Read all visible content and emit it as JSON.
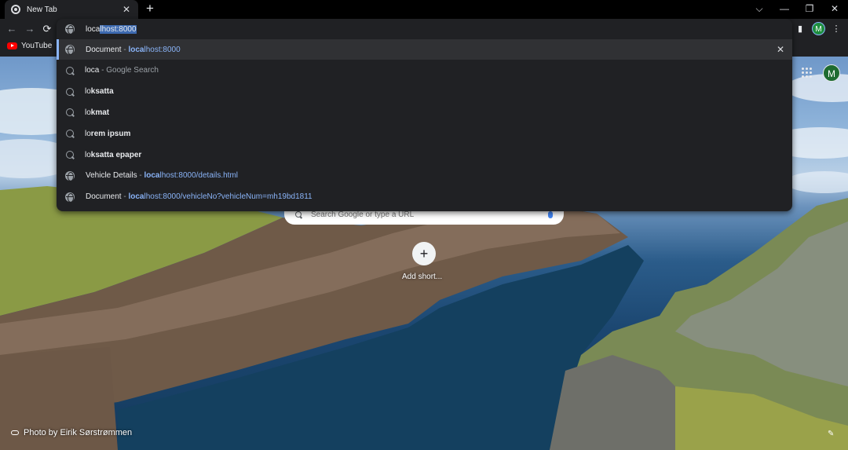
{
  "tab": {
    "title": "New Tab",
    "close": "✕",
    "new_tab": "+"
  },
  "window_controls": {
    "dropdown": "⌵",
    "minimize": "—",
    "restore": "❐",
    "close": "✕"
  },
  "toolbar": {
    "back": "←",
    "forward": "→",
    "reload": "⟳",
    "sidepanel": "▮",
    "profile": "M",
    "menu": "⋮"
  },
  "bookmarks": [
    {
      "label": "YouTube"
    }
  ],
  "omnibox": {
    "typed": "loca",
    "autocomplete": "lhost:8000",
    "suggestions": [
      {
        "icon": "globe-icon",
        "parts": [
          {
            "t": "Document",
            "c": ""
          },
          {
            "t": " - ",
            "c": "gray"
          },
          {
            "t": "loca",
            "c": "url b"
          },
          {
            "t": "lhost:8000",
            "c": "url"
          }
        ],
        "selected": true,
        "removable": true
      },
      {
        "icon": "search-icon",
        "parts": [
          {
            "t": "loca",
            "c": ""
          },
          {
            "t": " - Google Search",
            "c": "gray"
          }
        ]
      },
      {
        "icon": "search-icon",
        "parts": [
          {
            "t": "lo",
            "c": ""
          },
          {
            "t": "ksatta",
            "c": "b"
          }
        ]
      },
      {
        "icon": "search-icon",
        "parts": [
          {
            "t": "lo",
            "c": ""
          },
          {
            "t": "kmat",
            "c": "b"
          }
        ]
      },
      {
        "icon": "search-icon",
        "parts": [
          {
            "t": "lo",
            "c": ""
          },
          {
            "t": "rem ipsum",
            "c": "b"
          }
        ]
      },
      {
        "icon": "search-icon",
        "parts": [
          {
            "t": "lo",
            "c": ""
          },
          {
            "t": "ksatta epaper",
            "c": "b"
          }
        ]
      },
      {
        "icon": "globe-icon",
        "parts": [
          {
            "t": "Vehicle Details",
            "c": ""
          },
          {
            "t": " - ",
            "c": "gray"
          },
          {
            "t": "loca",
            "c": "url b"
          },
          {
            "t": "lhost:8000/details.html",
            "c": "url"
          }
        ]
      },
      {
        "icon": "globe-icon",
        "parts": [
          {
            "t": "Document",
            "c": ""
          },
          {
            "t": " - ",
            "c": "gray"
          },
          {
            "t": "loca",
            "c": "url b"
          },
          {
            "t": "lhost:8000/vehicleNo?vehicleNum=mh19bd1811",
            "c": "url"
          }
        ]
      }
    ],
    "remove": "✕"
  },
  "ntp": {
    "profile": "M",
    "search_placeholder": "Search Google or type a URL",
    "add_plus": "+",
    "add_label": "Add short...",
    "credit": "Photo by Eirik Sørstrømmen",
    "edit": "✎"
  },
  "colors": {
    "accent": "#8ab4f8",
    "surface": "#202124",
    "selected_row": "#303134",
    "selection": "#3d6ab0"
  }
}
